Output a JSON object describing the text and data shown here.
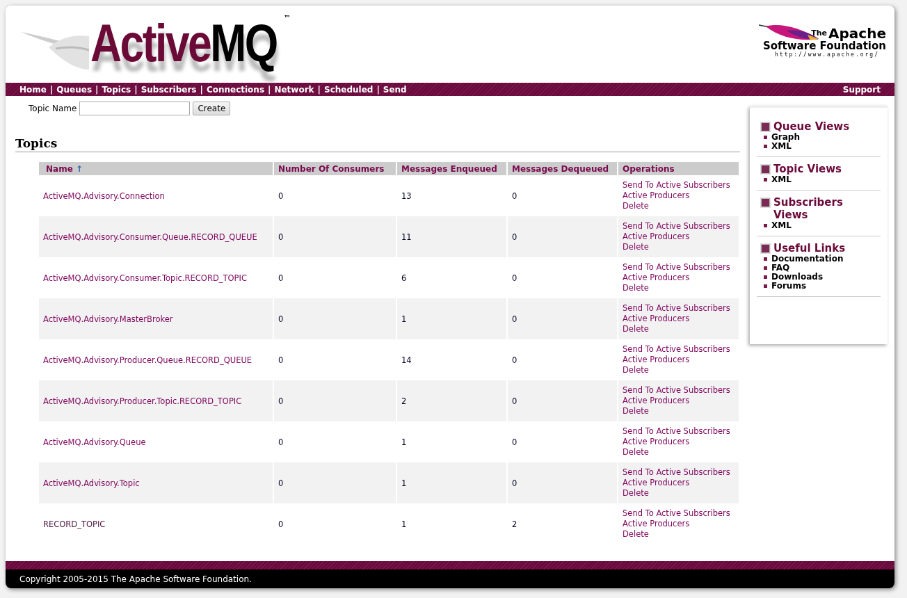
{
  "logo": {
    "title_a": "Active",
    "title_b": "MQ",
    "trademark": "™"
  },
  "apache_logo": {
    "the": "The",
    "apache": "Apache",
    "foundation": "Software Foundation",
    "url": "http://www.apache.org/"
  },
  "nav": {
    "items": [
      {
        "label": "Home",
        "separator": "|"
      },
      {
        "label": "Queues",
        "separator": "|"
      },
      {
        "label": "Topics",
        "separator": "|"
      },
      {
        "label": "Subscribers",
        "separator": "|"
      },
      {
        "label": "Connections",
        "separator": "|"
      },
      {
        "label": "Network",
        "separator": "|"
      },
      {
        "label": "Scheduled",
        "separator": "|"
      },
      {
        "label": "Send"
      }
    ],
    "support": "Support"
  },
  "create_form": {
    "label": "Topic Name",
    "button": "Create"
  },
  "title": "Topics",
  "table": {
    "columns": [
      {
        "label": "Name",
        "sort": "↑"
      },
      {
        "label": "Number Of Consumers"
      },
      {
        "label": "Messages Enqueued"
      },
      {
        "label": "Messages Dequeued"
      },
      {
        "label": "Operations"
      }
    ],
    "rows": [
      {
        "name": "ActiveMQ.Advisory.Connection",
        "visited": false,
        "consumers": "0",
        "enqueued": "13",
        "dequeued": "0",
        "operations": [
          "Send To Active Subscribers",
          "Active Producers",
          "Delete"
        ]
      },
      {
        "name": "ActiveMQ.Advisory.Consumer.Queue.RECORD_QUEUE",
        "visited": false,
        "consumers": "0",
        "enqueued": "11",
        "dequeued": "0",
        "operations": [
          "Send To Active Subscribers",
          "Active Producers",
          "Delete"
        ]
      },
      {
        "name": "ActiveMQ.Advisory.Consumer.Topic.RECORD_TOPIC",
        "visited": false,
        "consumers": "0",
        "enqueued": "6",
        "dequeued": "0",
        "operations": [
          "Send To Active Subscribers",
          "Active Producers",
          "Delete"
        ]
      },
      {
        "name": "ActiveMQ.Advisory.MasterBroker",
        "visited": false,
        "consumers": "0",
        "enqueued": "1",
        "dequeued": "0",
        "operations": [
          "Send To Active Subscribers",
          "Active Producers",
          "Delete"
        ]
      },
      {
        "name": "ActiveMQ.Advisory.Producer.Queue.RECORD_QUEUE",
        "visited": false,
        "consumers": "0",
        "enqueued": "14",
        "dequeued": "0",
        "operations": [
          "Send To Active Subscribers",
          "Active Producers",
          "Delete"
        ]
      },
      {
        "name": "ActiveMQ.Advisory.Producer.Topic.RECORD_TOPIC",
        "visited": false,
        "consumers": "0",
        "enqueued": "2",
        "dequeued": "0",
        "operations": [
          "Send To Active Subscribers",
          "Active Producers",
          "Delete"
        ]
      },
      {
        "name": "ActiveMQ.Advisory.Queue",
        "visited": false,
        "consumers": "0",
        "enqueued": "1",
        "dequeued": "0",
        "operations": [
          "Send To Active Subscribers",
          "Active Producers",
          "Delete"
        ]
      },
      {
        "name": "ActiveMQ.Advisory.Topic",
        "visited": false,
        "consumers": "0",
        "enqueued": "1",
        "dequeued": "0",
        "operations": [
          "Send To Active Subscribers",
          "Active Producers",
          "Delete"
        ]
      },
      {
        "name": "RECORD_TOPIC",
        "visited": true,
        "consumers": "0",
        "enqueued": "1",
        "dequeued": "2",
        "operations": [
          "Send To Active Subscribers",
          "Active Producers",
          "Delete"
        ]
      }
    ]
  },
  "sidebar": {
    "sections": [
      {
        "title": "Queue Views",
        "links": [
          "Graph",
          "XML"
        ]
      },
      {
        "title": "Topic Views",
        "links": [
          "XML"
        ]
      },
      {
        "title": "Subscribers Views",
        "links": [
          "XML"
        ]
      },
      {
        "title": "Useful Links",
        "links": [
          "Documentation",
          "FAQ",
          "Downloads",
          "Forums"
        ]
      }
    ]
  },
  "footer": {
    "copyright": "Copyright 2005-2015 The Apache Software Foundation."
  }
}
